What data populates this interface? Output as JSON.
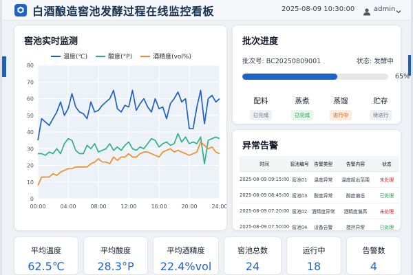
{
  "header": {
    "title": "白酒酿造窖池发酵过程在线监控看板",
    "datetime": "2025-08-09 10:30:00",
    "user": "admin"
  },
  "chart_panel": {
    "title": "窖池实时监测"
  },
  "chart_data": {
    "type": "line",
    "x": [
      "00:00",
      "00:30",
      "01:00",
      "01:30",
      "02:00",
      "02:30",
      "03:00",
      "03:30",
      "04:00",
      "04:30",
      "05:00",
      "05:30",
      "06:00",
      "06:30",
      "07:00",
      "07:30",
      "08:00",
      "08:30",
      "09:00",
      "09:30",
      "10:00",
      "10:30",
      "11:00",
      "11:30",
      "12:00",
      "12:30",
      "13:00",
      "13:30",
      "14:00",
      "14:30",
      "15:00",
      "15:30",
      "16:00",
      "16:30",
      "17:00",
      "17:30",
      "18:00",
      "18:30",
      "19:00",
      "19:30",
      "20:00",
      "20:30",
      "21:00",
      "21:30",
      "22:00",
      "22:30",
      "23:00",
      "23:30",
      "24:00"
    ],
    "series": [
      {
        "name": "温度(℃)",
        "color": "#1f5fbf",
        "values": [
          35,
          48,
          46,
          44,
          48,
          52,
          58,
          50,
          54,
          63,
          55,
          52,
          51,
          48,
          58,
          52,
          53,
          56,
          58,
          60,
          65,
          54,
          52,
          56,
          55,
          65,
          53,
          57,
          60,
          55,
          52,
          60,
          54,
          55,
          48,
          57,
          60,
          64,
          58,
          60,
          42,
          42,
          55,
          65,
          45,
          60,
          62,
          58,
          60
        ]
      },
      {
        "name": "酸度(°P)",
        "color": "#2bb08a",
        "values": [
          27,
          27,
          26,
          28,
          27,
          30,
          27,
          33,
          36,
          35,
          29,
          27,
          27,
          32,
          30,
          33,
          28,
          29,
          30,
          33,
          29,
          31,
          29,
          32,
          34,
          30,
          29,
          31,
          30,
          33,
          36,
          35,
          31,
          33,
          34,
          32,
          33,
          39,
          34,
          37,
          33,
          34,
          33,
          37,
          21,
          35,
          36,
          37,
          36
        ]
      },
      {
        "name": "酒精度(vol%)",
        "color": "#f28c28",
        "values": [
          8,
          13,
          13,
          13,
          15,
          14,
          16,
          17,
          18,
          18,
          19,
          19,
          19,
          19,
          21,
          22,
          24,
          22,
          22,
          21,
          25,
          23,
          25,
          25,
          27,
          25,
          25,
          27,
          28,
          28,
          27,
          26,
          25,
          28,
          29,
          30,
          28,
          29,
          28,
          27,
          26,
          27,
          28,
          34,
          32,
          30,
          31,
          28,
          27
        ]
      }
    ],
    "xticks": [
      "00:00",
      "04:00",
      "08:00",
      "12:00",
      "16:00",
      "20:00",
      "24:00"
    ],
    "ylim": [
      0,
      80
    ],
    "yticks": [
      0,
      10,
      20,
      30,
      40,
      50,
      60,
      70,
      80
    ],
    "grid": true,
    "legend": "top"
  },
  "batch": {
    "title": "批次进度",
    "batch_label": "批次号: BC20250809001",
    "status_label": "状态: 发酵中",
    "progress": 65,
    "progress_text": "65%",
    "steps": [
      {
        "name": "配料",
        "status": "已完成",
        "color": "#6b7280",
        "bg": "#eef0f3"
      },
      {
        "name": "蒸煮",
        "status": "已完成",
        "color": "#16a34a",
        "bg": "#e7f6ec"
      },
      {
        "name": "蒸馏",
        "status": "进行中",
        "color": "#ea580c",
        "bg": "#fdecdf"
      },
      {
        "name": "贮存",
        "status": "待进行",
        "color": "#6b7280",
        "bg": "#eef0f3"
      }
    ]
  },
  "alarms": {
    "title": "异常告警",
    "headers": [
      "时间",
      "窖池编号",
      "告警类型",
      "告警内容",
      "状态"
    ],
    "rows": [
      {
        "time": "2025-08-09 09:15:00",
        "pit": "窖池01",
        "type": "温度异常",
        "content": "温度超出范围",
        "status": "未处理",
        "status_color": "#dc2626"
      },
      {
        "time": "2025-08-09 08:45:00",
        "pit": "窖池03",
        "type": "酸度异常",
        "content": "酸度偏低",
        "status": "已处理",
        "status_color": "#16a34a"
      },
      {
        "time": "2025-08-09 07:20:00",
        "pit": "窖池02",
        "type": "酒精度异常",
        "content": "酒精度偏高",
        "status": "未处理",
        "status_color": "#dc2626"
      },
      {
        "time": "2025-08-09 07:50:00",
        "pit": "窖池04",
        "type": "设备告警",
        "content": "搅拌异常",
        "status": "已处理",
        "status_color": "#16a34a"
      }
    ]
  },
  "stats": [
    {
      "label": "平均温度",
      "value": "62.5",
      "unit": "℃"
    },
    {
      "label": "平均酸度",
      "value": "28.3",
      "unit": "°P"
    },
    {
      "label": "平均酒精度",
      "value": "22.4",
      "unit": "%vol"
    },
    {
      "label": "窖池总数",
      "value": "24",
      "unit": ""
    },
    {
      "label": "运行中",
      "value": "18",
      "unit": ""
    },
    {
      "label": "告警数",
      "value": "4",
      "unit": ""
    }
  ]
}
